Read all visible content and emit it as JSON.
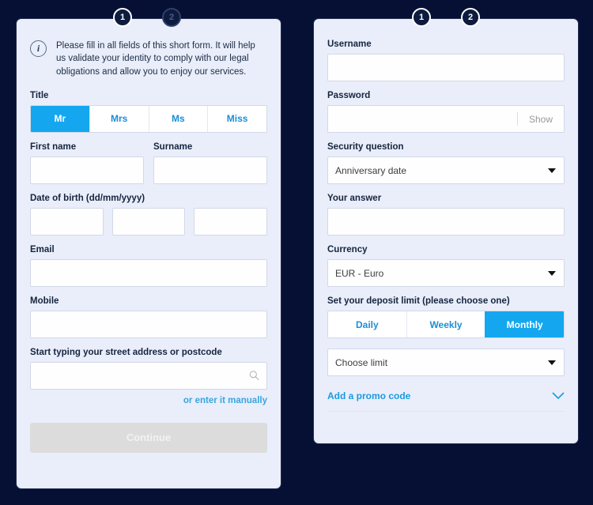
{
  "colors": {
    "page_bg": "#061034",
    "panel_bg": "#e9eefa",
    "accent_blue": "#14a7ef",
    "link_blue": "#1b9ae0",
    "label_navy": "#16253f",
    "disabled_button": "#dcdcdc"
  },
  "left_panel": {
    "steps": [
      {
        "number": "1",
        "state": "active"
      },
      {
        "number": "2",
        "state": "inactive"
      }
    ],
    "info": {
      "icon": "info-icon",
      "text": "Please fill in all fields of this short form. It will help us validate your identity to comply with our legal obligations and allow you to enjoy our services."
    },
    "title": {
      "label": "Title",
      "options": [
        "Mr",
        "Mrs",
        "Ms",
        "Miss"
      ],
      "selected": "Mr"
    },
    "first_name": {
      "label": "First name",
      "value": "",
      "placeholder": ""
    },
    "surname": {
      "label": "Surname",
      "value": "",
      "placeholder": ""
    },
    "date_of_birth": {
      "label": "Date of birth (dd/mm/yyyy)",
      "day": {
        "value": "",
        "placeholder": ""
      },
      "month": {
        "value": "",
        "placeholder": ""
      },
      "year": {
        "value": "",
        "placeholder": ""
      }
    },
    "email": {
      "label": "Email",
      "value": "",
      "placeholder": ""
    },
    "mobile": {
      "label": "Mobile",
      "value": "",
      "placeholder": ""
    },
    "address": {
      "label": "Start typing your street address or postcode",
      "value": "",
      "placeholder": "",
      "icon": "search-icon"
    },
    "manual_link": "or enter it manually",
    "continue_button": {
      "label": "Continue",
      "state": "disabled"
    }
  },
  "right_panel": {
    "steps": [
      {
        "number": "1",
        "state": "active"
      },
      {
        "number": "2",
        "state": "active"
      }
    ],
    "username": {
      "label": "Username",
      "value": "",
      "placeholder": ""
    },
    "password": {
      "label": "Password",
      "value": "",
      "placeholder": "",
      "show_label": "Show"
    },
    "security_question": {
      "label": "Security question",
      "selected": "Anniversary date",
      "caret": "chevron-down-icon"
    },
    "your_answer": {
      "label": "Your answer",
      "value": "",
      "placeholder": ""
    },
    "currency": {
      "label": "Currency",
      "selected": "EUR - Euro",
      "caret": "chevron-down-icon"
    },
    "deposit_limit": {
      "label": "Set your deposit limit (please choose one)",
      "options": [
        "Daily",
        "Weekly",
        "Monthly"
      ],
      "selected": "Monthly"
    },
    "limit_select": {
      "selected": "Choose limit",
      "caret": "chevron-down-icon"
    },
    "promo": {
      "label": "Add a promo code",
      "icon": "chevron-down-icon"
    }
  }
}
